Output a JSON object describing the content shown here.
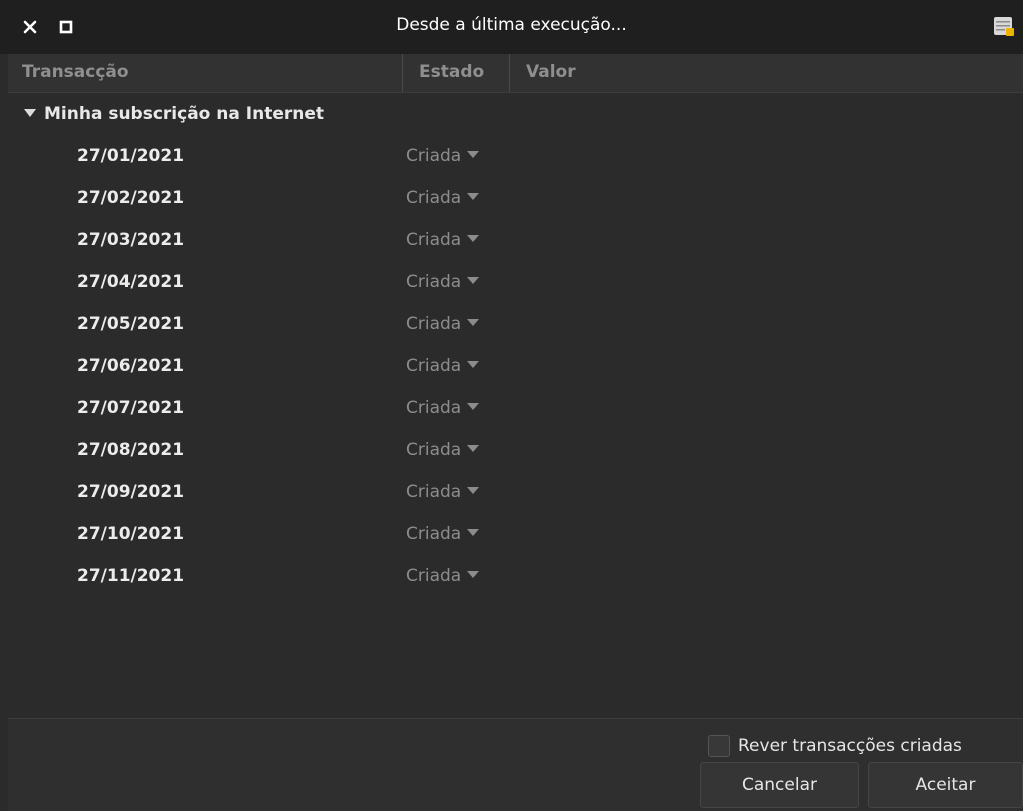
{
  "window": {
    "title": "Desde a última execução..."
  },
  "columns": {
    "transaction": "Transacção",
    "state": "Estado",
    "value": "Valor"
  },
  "group": {
    "label": "Minha subscrição na Internet",
    "expanded": true
  },
  "rows": [
    {
      "date": "27/01/2021",
      "state": "Criada"
    },
    {
      "date": "27/02/2021",
      "state": "Criada"
    },
    {
      "date": "27/03/2021",
      "state": "Criada"
    },
    {
      "date": "27/04/2021",
      "state": "Criada"
    },
    {
      "date": "27/05/2021",
      "state": "Criada"
    },
    {
      "date": "27/06/2021",
      "state": "Criada"
    },
    {
      "date": "27/07/2021",
      "state": "Criada"
    },
    {
      "date": "27/08/2021",
      "state": "Criada"
    },
    {
      "date": "27/09/2021",
      "state": "Criada"
    },
    {
      "date": "27/10/2021",
      "state": "Criada"
    },
    {
      "date": "27/11/2021",
      "state": "Criada"
    }
  ],
  "footer": {
    "review_label": "Rever transacções criadas",
    "review_checked": false,
    "cancel_label": "Cancelar",
    "accept_label": "Aceitar"
  },
  "colors": {
    "background": "#2b2b2b",
    "titlebar": "#1f1f1f",
    "muted_text": "#8c8c8c"
  },
  "icons": {
    "close": "close-icon",
    "maximize": "maximize-icon",
    "app": "spreadsheet-icon",
    "expander": "triangle-down-icon",
    "dropdown": "chevron-down-icon"
  }
}
